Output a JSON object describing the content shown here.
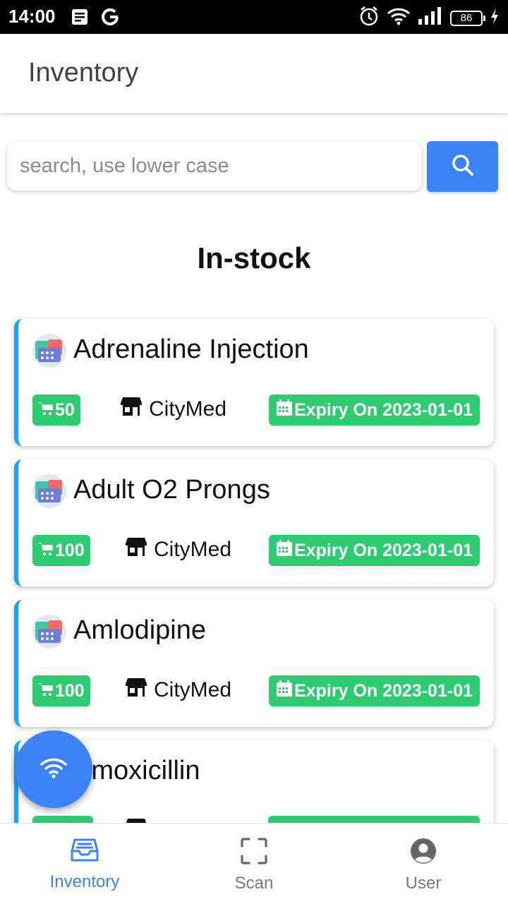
{
  "status_bar": {
    "time": "14:00",
    "battery": "86",
    "icons": [
      "notes-icon",
      "google-g-icon",
      "alarm-icon",
      "wifi-icon",
      "signal-icon",
      "battery-icon",
      "charging-icon"
    ]
  },
  "app_bar": {
    "title": "Inventory"
  },
  "search": {
    "placeholder": "search, use lower case",
    "value": "",
    "button_icon": "search-icon"
  },
  "section": {
    "title": "In-stock"
  },
  "colors": {
    "accent": "#3b82f6",
    "badge_green": "#2ecc71",
    "card_border": "#1aa3f0"
  },
  "items": [
    {
      "name": "Adrenaline Injection",
      "quantity": "50",
      "store": "CityMed",
      "expiry": "Expiry On 2023-01-01"
    },
    {
      "name": "Adult O2 Prongs",
      "quantity": "100",
      "store": "CityMed",
      "expiry": "Expiry On 2023-01-01"
    },
    {
      "name": "Amlodipine",
      "quantity": "100",
      "store": "CityMed",
      "expiry": "Expiry On 2023-01-01"
    },
    {
      "name": "Amoxicillin",
      "quantity": "",
      "store": "",
      "expiry": ""
    }
  ],
  "fab": {
    "icon": "wifi-icon"
  },
  "bottom_nav": [
    {
      "label": "Inventory",
      "icon": "inventory-tray-icon",
      "active": true
    },
    {
      "label": "Scan",
      "icon": "scan-frame-icon",
      "active": false
    },
    {
      "label": "User",
      "icon": "user-circle-icon",
      "active": false
    }
  ]
}
